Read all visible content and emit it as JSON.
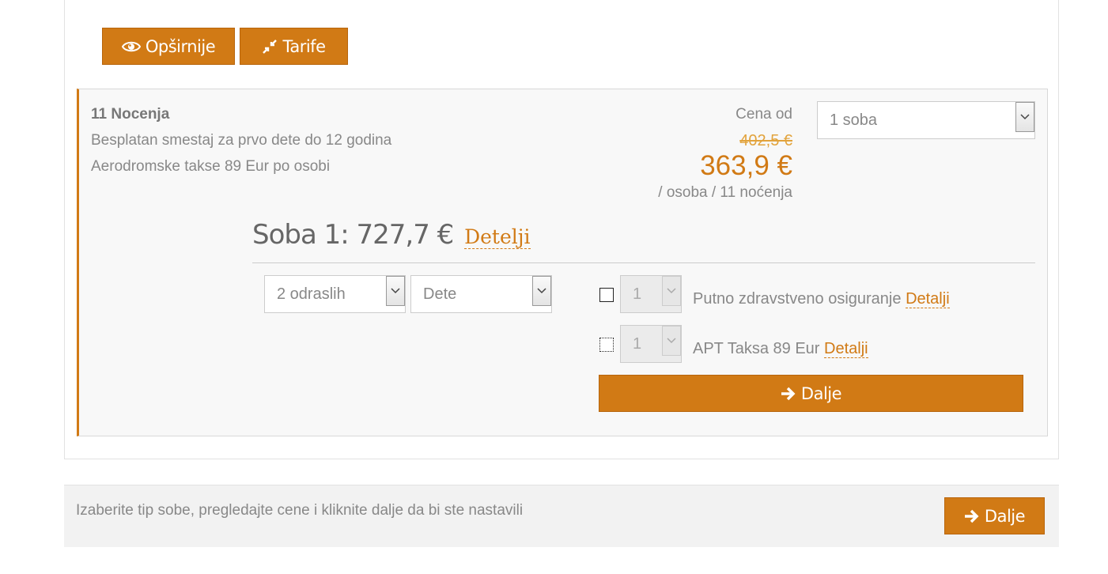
{
  "toolbar": {
    "more_label": "Opširnije",
    "tariffs_label": "Tarife"
  },
  "rate": {
    "nights": "11 Nocenja",
    "note1": "Besplatan smestaj za prvo dete do 12 godina",
    "note2": "Aerodromske takse 89 Eur po osobi",
    "price_from_label": "Cena od",
    "old_price": "402,5 €",
    "new_price": "363,9 €",
    "per_label": "/ osoba / 11 noćenja",
    "rooms_select": "1 soba"
  },
  "room": {
    "title": "Soba 1: 727,7 €",
    "details_link": "Detelji",
    "adults_select": "2 odraslih",
    "child_select": "Dete"
  },
  "extras": [
    {
      "qty": "1",
      "label": "Putno zdravstveno osiguranje",
      "details": "Detalji"
    },
    {
      "qty": "1",
      "label": "APT Taksa 89 Eur",
      "details": "Detalji"
    }
  ],
  "actions": {
    "next_label": "Dalje"
  },
  "footer": {
    "hint": "Izaberite tip sobe, pregledajte cene i kliknite dalje da bi ste nastavili",
    "next_label": "Dalje"
  },
  "colors": {
    "accent": "#d17a15",
    "text": "#777777"
  }
}
